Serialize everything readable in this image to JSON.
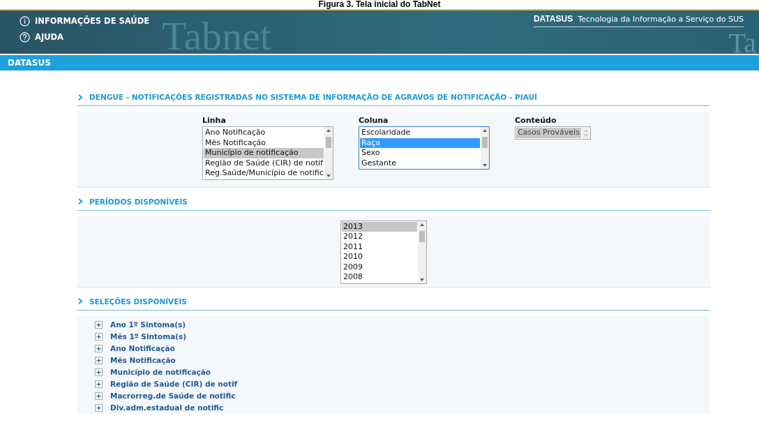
{
  "caption": "Figura 3. Tela inicial do TabNet",
  "header": {
    "menu": [
      {
        "kind": "info",
        "label": "INFORMAÇÕES DE SAÚDE"
      },
      {
        "kind": "help",
        "label": "AJUDA"
      }
    ],
    "logo_text": "Tabnet",
    "logo_text_right": "Ta",
    "brand": "DATASUS",
    "tagline": "Tecnologia da Informação a Serviço do SUS"
  },
  "nav_bar": {
    "label": "DATASUS"
  },
  "sections": [
    {
      "kind": "selects",
      "title": "DENGUE - NOTIFICAÇÕES REGISTRADAS NO SISTEMA DE INFORMAÇÃO DE AGRAVOS DE NOTIFICAÇÃO - PIAUÍ",
      "lists": [
        {
          "label": "Linha",
          "focused": false,
          "disabled": false,
          "items": [
            {
              "text": "Ano Notificação",
              "selected": false
            },
            {
              "text": "Mês Notificação",
              "selected": false
            },
            {
              "text": "Município de notificação",
              "selected": true
            },
            {
              "text": "Região de Saúde (CIR) de notif",
              "selected": false
            },
            {
              "text": "Reg.Saúde/Município de notific",
              "selected": false
            }
          ]
        },
        {
          "label": "Coluna",
          "focused": true,
          "disabled": false,
          "items": [
            {
              "text": "Escolaridade",
              "selected": false
            },
            {
              "text": "Raça",
              "selected": true
            },
            {
              "text": "Sexo",
              "selected": false
            },
            {
              "text": "Gestante",
              "selected": false
            }
          ]
        },
        {
          "label": "Conteúdo",
          "focused": false,
          "disabled": true,
          "items": [
            {
              "text": "Casos Prováveis",
              "selected": true
            }
          ]
        }
      ]
    },
    {
      "kind": "periods",
      "title": "PERÍODOS DISPONÍVEIS",
      "lists": [
        {
          "focused": false,
          "disabled": false,
          "items": [
            {
              "text": "2013",
              "selected": true
            },
            {
              "text": "2012",
              "selected": false
            },
            {
              "text": "2011",
              "selected": false
            },
            {
              "text": "2010",
              "selected": false
            },
            {
              "text": "2009",
              "selected": false
            },
            {
              "text": "2008",
              "selected": false
            }
          ]
        }
      ]
    },
    {
      "kind": "tree",
      "title": "SELEÇÕES DISPONÍVEIS",
      "items": [
        {
          "text": "Ano 1º Sintoma(s)",
          "expanded": false
        },
        {
          "text": "Mês 1º Sintoma(s)",
          "expanded": false
        },
        {
          "text": "Ano Notificação",
          "expanded": false
        },
        {
          "text": "Mês Notificação",
          "expanded": false
        },
        {
          "text": "Município de notificação",
          "expanded": false
        },
        {
          "text": "Região de Saúde (CIR) de notif",
          "expanded": false
        },
        {
          "text": "Macrorreg.de Saúde de notific",
          "expanded": false
        },
        {
          "text": "Div.adm.estadual de notific",
          "expanded": false
        }
      ]
    }
  ]
}
